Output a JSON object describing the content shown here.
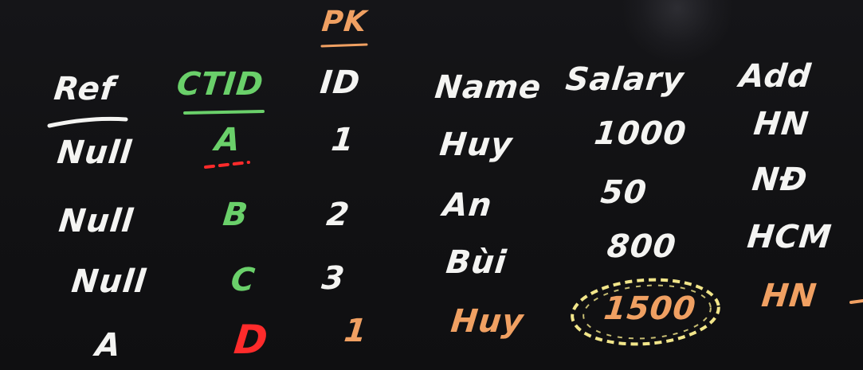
{
  "pk_label": "PK",
  "headers": {
    "ref": "Ref",
    "ctid": "CTID",
    "id": "ID",
    "name": "Name",
    "salary": "Salary",
    "add": "Add"
  },
  "rows": [
    {
      "ref": "Null",
      "ctid": "A",
      "id": "1",
      "name": "Huy",
      "salary": "1000",
      "add": "HN"
    },
    {
      "ref": "Null",
      "ctid": "B",
      "id": "2",
      "name": "An",
      "salary": "50",
      "add": "NĐ"
    },
    {
      "ref": "Null",
      "ctid": "C",
      "id": "3",
      "name": "Bùi",
      "salary": "800",
      "add": "HCM"
    },
    {
      "ref": "A",
      "ctid": "D",
      "id": "1",
      "name": "Huy",
      "salary": "1500",
      "add": "HN"
    }
  ],
  "colors": {
    "background": "#121214",
    "chalk": "#f4f4f2",
    "ctid": "#6ad06a",
    "highlight": "#f0a062",
    "new_ctid": "#ff2b2b",
    "circle": "#f2e68a"
  }
}
